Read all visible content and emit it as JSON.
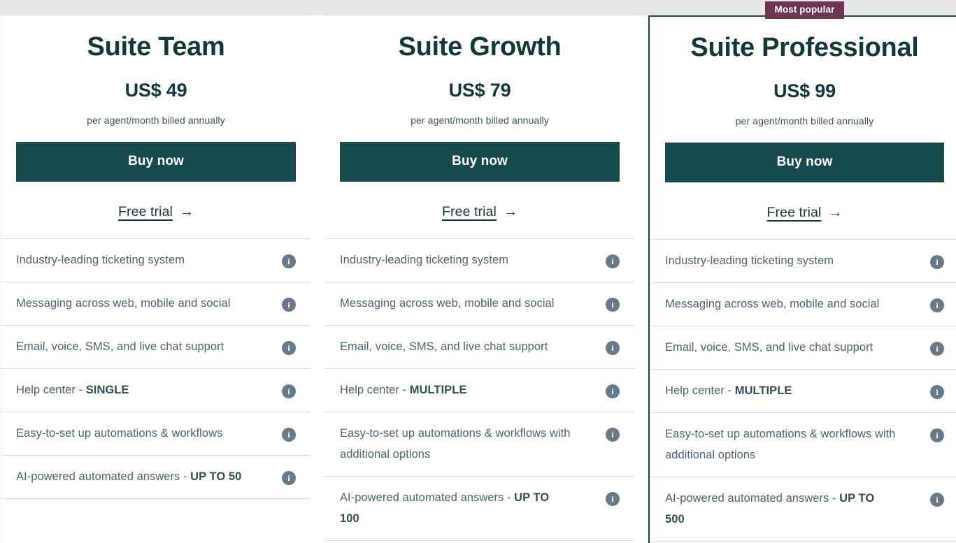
{
  "page": {
    "background_color": "#e6e7e7",
    "accent_color": "#17494d",
    "badge_color": "#6e3552",
    "feature_text_color": "#4a6570",
    "info_icon_color": "#68798a"
  },
  "badge": {
    "label": "Most popular"
  },
  "icons": {
    "info": "i",
    "arrow_right": "→"
  },
  "plans": [
    {
      "name": "Suite Team",
      "price": "US$ 49",
      "period": "per agent/month billed annually",
      "buy_label": "Buy now",
      "trial_label": "Free trial",
      "featured": false,
      "features": [
        {
          "text": "Industry-leading ticketing system",
          "bold": ""
        },
        {
          "text": "Messaging across web, mobile and social",
          "bold": ""
        },
        {
          "text": "Email, voice, SMS, and live chat support",
          "bold": ""
        },
        {
          "text": "Help center - ",
          "bold": "SINGLE"
        },
        {
          "text": "Easy-to-set up automations & workflows",
          "bold": ""
        },
        {
          "text": "AI-powered automated answers - ",
          "bold": "UP TO 50"
        }
      ]
    },
    {
      "name": "Suite Growth",
      "price": "US$ 79",
      "period": "per agent/month billed annually",
      "buy_label": "Buy now",
      "trial_label": "Free trial",
      "featured": false,
      "features": [
        {
          "text": "Industry-leading ticketing system",
          "bold": ""
        },
        {
          "text": "Messaging across web, mobile and social",
          "bold": ""
        },
        {
          "text": "Email, voice, SMS, and live chat support",
          "bold": ""
        },
        {
          "text": "Help center - ",
          "bold": "MULTIPLE"
        },
        {
          "text": "Easy-to-set up automations & workflows with additional options",
          "bold": ""
        },
        {
          "text": "AI-powered automated answers - ",
          "bold": "UP TO 100"
        }
      ]
    },
    {
      "name": "Suite Professional",
      "price": "US$ 99",
      "period": "per agent/month billed annually",
      "buy_label": "Buy now",
      "trial_label": "Free trial",
      "featured": true,
      "features": [
        {
          "text": "Industry-leading ticketing system",
          "bold": ""
        },
        {
          "text": "Messaging across web, mobile and social",
          "bold": ""
        },
        {
          "text": "Email, voice, SMS, and live chat support",
          "bold": ""
        },
        {
          "text": "Help center - ",
          "bold": "MULTIPLE"
        },
        {
          "text": "Easy-to-set up automations & workflows with additional options",
          "bold": ""
        },
        {
          "text": "AI-powered automated answers - ",
          "bold": "UP TO 500"
        }
      ]
    }
  ]
}
